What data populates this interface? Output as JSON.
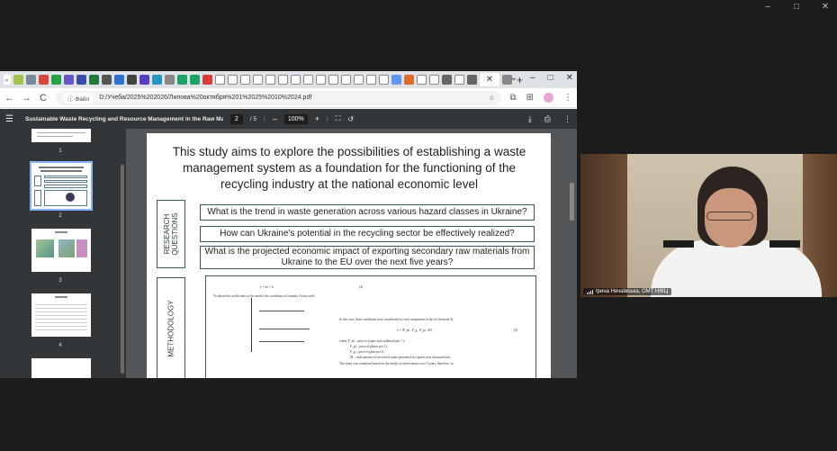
{
  "os_window": {
    "controls": [
      "–",
      "□",
      "✕"
    ]
  },
  "browser": {
    "active_tab_close": "✕",
    "new_tab": "+",
    "window_controls": [
      "⌄",
      "–",
      "□",
      "✕"
    ],
    "nav": {
      "back": "←",
      "forward": "→",
      "reload": "C"
    },
    "site_chip": "Файл",
    "url": "D:/Учеба/2025%202026/Липова%20октября%201%2025%2010%2024.pdf",
    "right_icons": [
      "☆",
      "⧉",
      "⊞",
      "⋮"
    ]
  },
  "pdf_toolbar": {
    "menu_icon": "☰",
    "title": "Sustainable Waste Recycling and Resource Management in the Raw Ma...",
    "page_current": "2",
    "page_total": "/ 5",
    "zoom_minus": "–",
    "zoom": "100%",
    "zoom_plus": "+",
    "right_icons": [
      "⤓",
      "⎙",
      "⋮"
    ]
  },
  "thumbnails": [
    {
      "num": "1"
    },
    {
      "num": "2"
    },
    {
      "num": "3"
    },
    {
      "num": "4"
    }
  ],
  "slide": {
    "title": "This study aims to explore the possibilities of establishing a waste management system as a foundation for the functioning of the recycling industry at the national economic level",
    "rq_label": "RESEARCH QUESTIONS",
    "questions": [
      "What is the trend in waste generation across various hazard classes in Ukraine?",
      "How can Ukraine's potential in the recycling sector be effectively realized?",
      "What is the projected economic impact of exporting secondary raw materials from Ukraine to the EU over the next five years?"
    ],
    "methodology_label": "METHODOLOGY",
    "meth_lines": {
      "l1": "y = ax + b",
      "l1num": "(4)",
      "l2": "To obtain the coefficients of the model, the conditions of formula 2 were used:",
      "l3": "In this case, three conditions were considered for each component of the set (formula 5).",
      "l4": "s = {P_ab , P_g , P_pl , M},",
      "l4num": "(5)",
      "l5": "where P_ab – price of paper and cardboard per 1 t;",
      "l6": "P_pl – price of plastic per 1t;",
      "l7": "P_g – price of glass per 1t;",
      "l8": "M – total amount of recovered waste generated in a given year, thousand tons.",
      "l9": "The study was conducted based on the results of observations over 5 years; therefore, in"
    }
  },
  "video": {
    "participant": "Ірина Нечаївська, OMT НЖЦ"
  }
}
